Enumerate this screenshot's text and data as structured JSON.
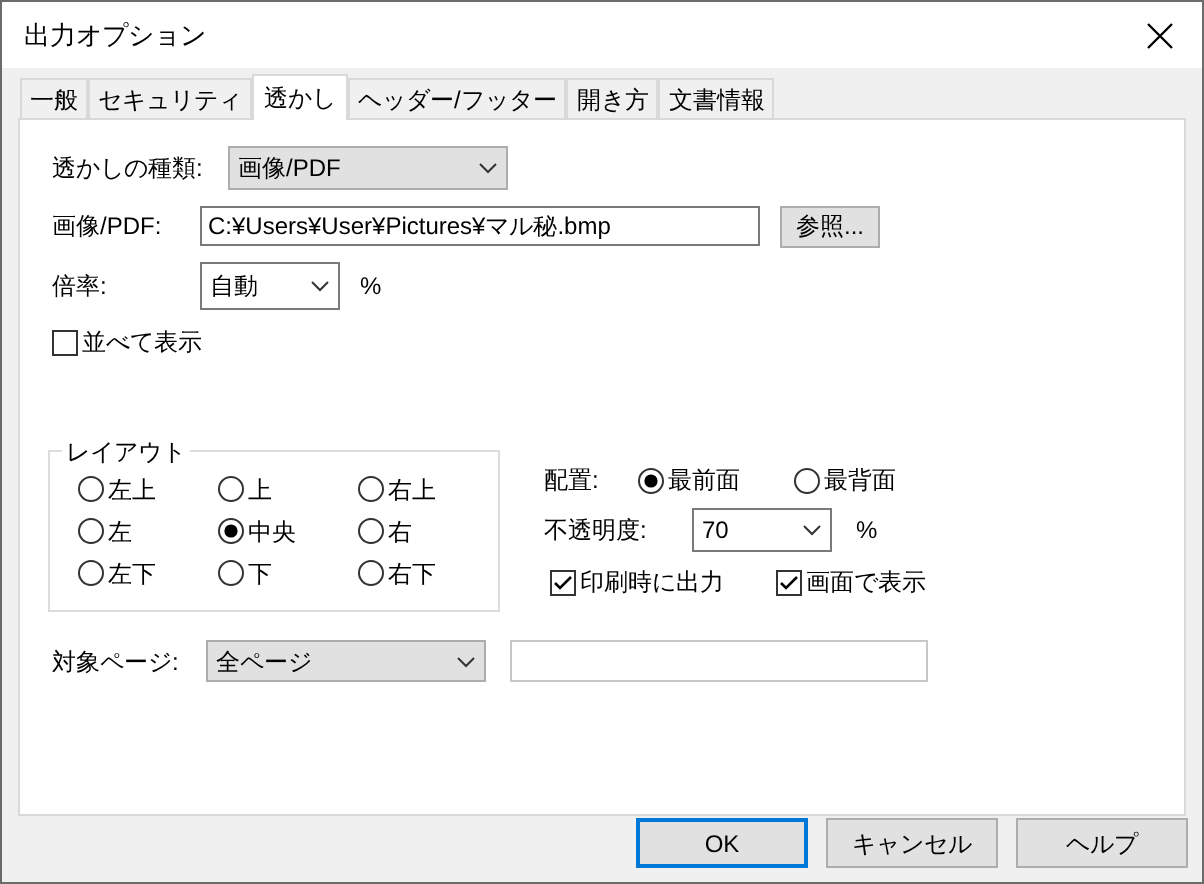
{
  "window": {
    "title": "出力オプション"
  },
  "tabs": [
    {
      "label": "一般",
      "selected": false
    },
    {
      "label": "セキュリティ",
      "selected": false
    },
    {
      "label": "透かし",
      "selected": true
    },
    {
      "label": "ヘッダー/フッター",
      "selected": false
    },
    {
      "label": "開き方",
      "selected": false
    },
    {
      "label": "文書情報",
      "selected": false
    }
  ],
  "watermark_type": {
    "label": "透かしの種類:",
    "value": "画像/PDF"
  },
  "image_pdf": {
    "label": "画像/PDF:",
    "value": "C:¥Users¥User¥Pictures¥マル秘.bmp",
    "browse_button": "参照..."
  },
  "scale": {
    "label": "倍率:",
    "value": "自動",
    "unit": "%"
  },
  "tile": {
    "label": "並べて表示",
    "checked": false
  },
  "layout": {
    "title": "レイアウト",
    "options": [
      {
        "label": "左上",
        "selected": false
      },
      {
        "label": "上",
        "selected": false
      },
      {
        "label": "右上",
        "selected": false
      },
      {
        "label": "左",
        "selected": false
      },
      {
        "label": "中央",
        "selected": true
      },
      {
        "label": "右",
        "selected": false
      },
      {
        "label": "左下",
        "selected": false
      },
      {
        "label": "下",
        "selected": false
      },
      {
        "label": "右下",
        "selected": false
      }
    ]
  },
  "placement": {
    "label": "配置:",
    "options": [
      {
        "label": "最前面",
        "selected": true
      },
      {
        "label": "最背面",
        "selected": false
      }
    ]
  },
  "opacity": {
    "label": "不透明度:",
    "value": "70",
    "unit": "%"
  },
  "print_output": {
    "label": "印刷時に出力",
    "checked": true
  },
  "show_on_screen": {
    "label": "画面で表示",
    "checked": true
  },
  "target_pages": {
    "label": "対象ページ:",
    "value": "全ページ"
  },
  "buttons": [
    {
      "label": "OK",
      "default": true
    },
    {
      "label": "キャンセル",
      "default": false
    },
    {
      "label": "ヘルプ",
      "default": false
    }
  ]
}
